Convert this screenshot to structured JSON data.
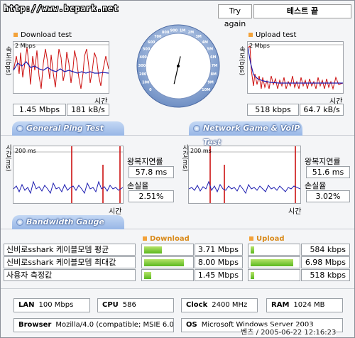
{
  "url_watermark": "http://www.bcpark.net",
  "buttons": {
    "try_again": "Try again",
    "status": "테스트 끝"
  },
  "download": {
    "title": "Download test",
    "y_axis": "속도(bps)",
    "scale": "2 Mbps",
    "x_axis": "시간",
    "mbps": "1.45 Mbps",
    "kbs": "181 kB/s"
  },
  "upload": {
    "title": "Upload test",
    "y_axis": "속도(bps)",
    "scale": "2 Mbps",
    "x_axis": "시간",
    "kbps": "518 kbps",
    "kbs": "64.7 kB/s"
  },
  "gauge": {
    "ticks": [
      "0",
      "100",
      "200",
      "300",
      "400",
      "500",
      "600",
      "700",
      "800",
      "900",
      "1M",
      "2M",
      "3M",
      "4M",
      "5M",
      "6M",
      "7M",
      "8M",
      "9M",
      "10M"
    ],
    "needle_value": "1.45M"
  },
  "tabs": {
    "ping": "General Ping Test",
    "game": "Network Game & VoIP Test",
    "bandwidth": "Bandwidth Gauge"
  },
  "ping": {
    "y_axis": "시간(ms)",
    "scale": "200 ms",
    "x_axis": "시간",
    "rtt_label": "왕복지연률",
    "rtt": "57.8 ms",
    "loss_label": "손실율",
    "loss": "2.51%"
  },
  "game": {
    "y_axis": "시간(ms)",
    "scale": "200 ms",
    "x_axis": "시간",
    "rtt_label": "왕복지연률",
    "rtt": "51.6 ms",
    "loss_label": "손실율",
    "loss": "3.02%"
  },
  "bandwidth": {
    "download_header": "Download",
    "upload_header": "Upload",
    "rows": [
      {
        "label": "신비로sshark 케이블모뎀 평균",
        "down": "3.71 Mbps",
        "down_fill": 0.37,
        "up": "584 kbps",
        "up_fill": 0.08
      },
      {
        "label": "신비로sshark 케이블모뎀 최대값",
        "down": "8.00 Mbps",
        "down_fill": 0.82,
        "up": "6.98 Mbps",
        "up_fill": 0.88
      },
      {
        "label": "사용자 측정값",
        "down": "1.45 Mbps",
        "down_fill": 0.15,
        "up": "518 kbps",
        "up_fill": 0.07
      }
    ]
  },
  "info": {
    "lan_label": "LAN",
    "lan": "100 Mbps",
    "cpu_label": "CPU",
    "cpu": "586",
    "clock_label": "Clock",
    "clock": "2400 MHz",
    "ram_label": "RAM",
    "ram": "1024 MB",
    "browser_label": "Browser",
    "browser": "Mozilla/4.0 (compatible; MSIE 6.0",
    "os_label": "OS",
    "os": "Microsoft Windows Server 2003"
  },
  "footer": "벤츠 / 2005-06-22 12:16:23",
  "colors": {
    "series_red": "#cc1010",
    "series_blue": "#1c1cb0",
    "tab_blue": "#97b6e6",
    "bar_green": "#6cc226",
    "accent_orange": "#f3a23a"
  }
}
